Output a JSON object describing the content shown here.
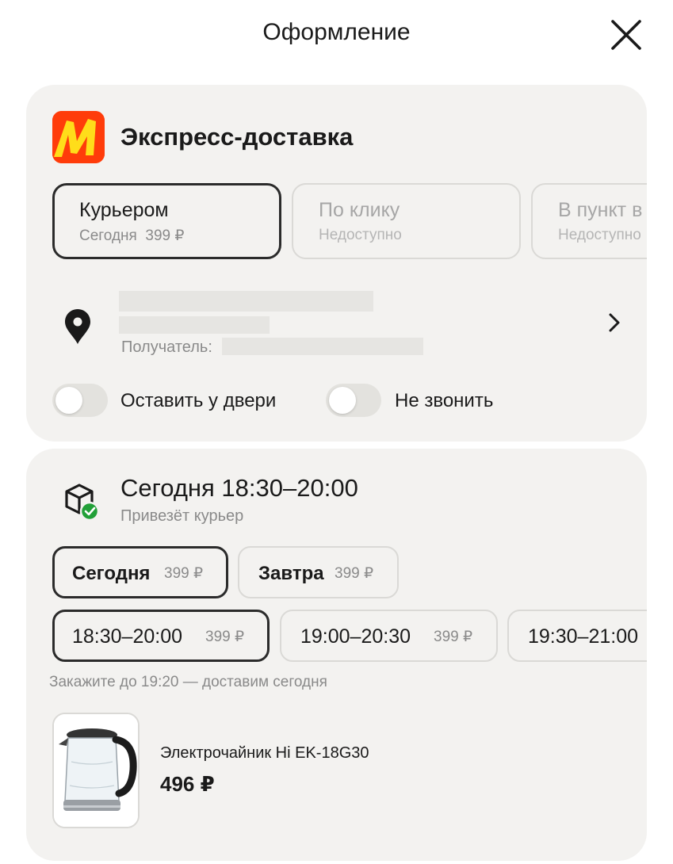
{
  "header": {
    "title": "Оформление"
  },
  "delivery": {
    "title": "Экспресс-доставка",
    "options": [
      {
        "title": "Курьером",
        "subtitle": "Сегодня  399 ₽",
        "selected": true
      },
      {
        "title": "По клику",
        "subtitle": "Недоступно",
        "selected": false
      },
      {
        "title": "В пункт в",
        "subtitle": "Недоступно",
        "selected": false
      }
    ],
    "recipient_label": "Получатель:",
    "toggles": [
      {
        "label": "Оставить у двери",
        "on": false
      },
      {
        "label": "Не звонить",
        "on": false
      }
    ]
  },
  "slot": {
    "title": "Сегодня 18:30–20:00",
    "subtitle": "Привезёт курьер",
    "days": [
      {
        "label": "Сегодня",
        "price": "399 ₽",
        "selected": true
      },
      {
        "label": "Завтра",
        "price": "399 ₽",
        "selected": false
      }
    ],
    "times": [
      {
        "label": "18:30–20:00",
        "price": "399 ₽",
        "selected": true
      },
      {
        "label": "19:00–20:30",
        "price": "399 ₽",
        "selected": false
      },
      {
        "label": "19:30–21:00",
        "price": "",
        "selected": false
      }
    ],
    "note": "Закажите до 19:20 — доставим сегодня"
  },
  "product": {
    "name": "Электрочайник Hi EK-18G30",
    "price": "496 ₽"
  },
  "colors": {
    "card_bg": "#f3f2f0",
    "logo_red": "#ff3c0a",
    "logo_yellow": "#ffdd1a",
    "check_green": "#21a038",
    "selected_border": "#2b2b2b"
  }
}
